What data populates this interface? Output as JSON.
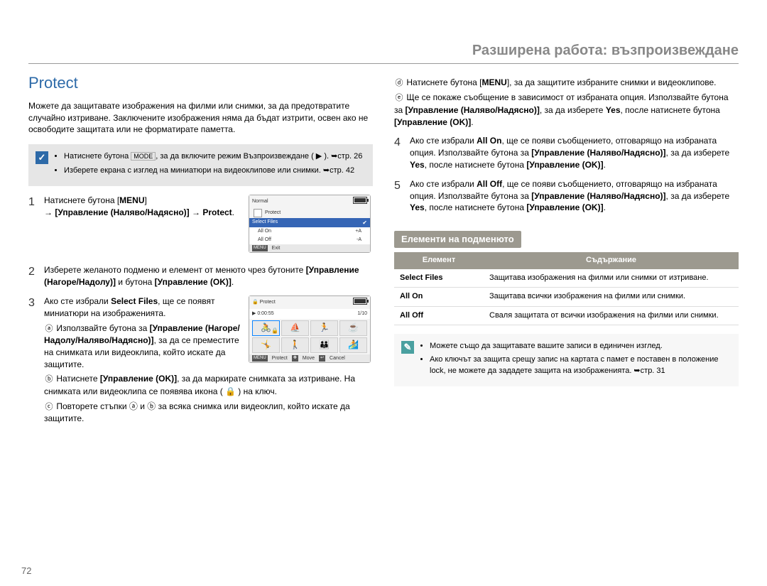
{
  "page_number": "72",
  "chapter_title": "Разширена работа: възпроизвеждане",
  "section_title": "Protect",
  "intro": "Можете да защитавате изображения на филми или снимки, за да предотвратите случайно изтриване. Заключените изображения няма да бъдат изтрити, освен ако не освободите защитата или не форматирате паметта.",
  "info1": {
    "items": [
      "Натиснете бутона MODE, за да включите режим Възпроизвеждане ( ▶ ). ➥стр. 26",
      "Изберете екрана с изглед на миниатюри на видеоклипове или снимки. ➥стр. 42"
    ]
  },
  "mode_key": "MODE",
  "steps": {
    "s1": {
      "n": "1",
      "text_a": "Натиснете бутона ",
      "bold_a": "MENU",
      "text_b": " → ",
      "bold_b": "[Управление (Наляво/Надясно)]",
      "text_c": " → ",
      "bold_c": "Protect",
      "tail": "."
    },
    "s2": {
      "n": "2",
      "text": "Изберете желаното подменю и елемент от менюто чрез бутоните [Управление (Нагоре/Надолу)] и бутона [Управление (OK)]."
    },
    "s3": {
      "n": "3",
      "pre": "Ако сте избрали ",
      "bold": "Select Files",
      "post": ", ще се появят миниатюри на изображенията.",
      "a": "Използвайте бутона за [Управление (Нагоре/Надолу/Наляво/Надясно)], за да се преместите на снимката или видеоклипа, който искате да защитите.",
      "b": "Натиснете [Управление (OK)], за да маркирате снимката за изтриване. На снимката или видеоклипа се появява икона ( 🔒 ) на ключ.",
      "c": "Повторете стъпки ⓐ и ⓑ за всяка снимка или видеоклип, който искате да защитите."
    },
    "s3d": "Натиснете бутона [MENU], за да защитите избраните снимки и видеоклипове.",
    "s3e": "Ще се покаже съобщение в зависимост от избраната опция. Използвайте бутона за [Управление (Наляво/Надясно)], за да изберете Yes, после натиснете бутона [Управление (OK)].",
    "s4": {
      "n": "4",
      "text": "Ако сте избрали All On, ще се появи съобщението, отговарящо на избраната опция. Използвайте бутона за [Управление (Наляво/Надясно)], за да изберете Yes, после натиснете бутона [Управление (OK)]."
    },
    "s5": {
      "n": "5",
      "text": "Ако сте избрали All Off, ще се появи съобщението, отговарящо на избраната опция. Използвайте бутона за [Управление (Наляво/Надясно)], за да изберете Yes, после натиснете бутона [Управление (OK)]."
    }
  },
  "lcd1": {
    "title": "Normal",
    "item_protect": "Protect",
    "item_select": "Select Files",
    "item_allon": "All On",
    "item_alloff": "All Off",
    "menu": "MENU",
    "exit": "Exit"
  },
  "lcd2": {
    "title": "Protect",
    "time": "0:00:55",
    "count": "1/10",
    "menu": "MENU",
    "protect": "Protect",
    "move": "Move",
    "cancel": "Cancel"
  },
  "subhead": "Елементи на подменюто",
  "table": {
    "h1": "Елемент",
    "h2": "Съдържание",
    "rows": [
      {
        "k": "Select Files",
        "v": "Защитава изображения на филми или снимки от изтриване."
      },
      {
        "k": "All On",
        "v": "Защитава всички изображения на филми или снимки."
      },
      {
        "k": "All Off",
        "v": "Сваля защитата от всички изображения на филми или снимки."
      }
    ]
  },
  "info2": {
    "items": [
      "Можете също да защитавате вашите записи в единичен изглед.",
      "Ако ключът за защита срещу запис на картата с памет е поставен в положение lock, не можете да зададете защита на изображенията. ➥стр. 31"
    ]
  }
}
